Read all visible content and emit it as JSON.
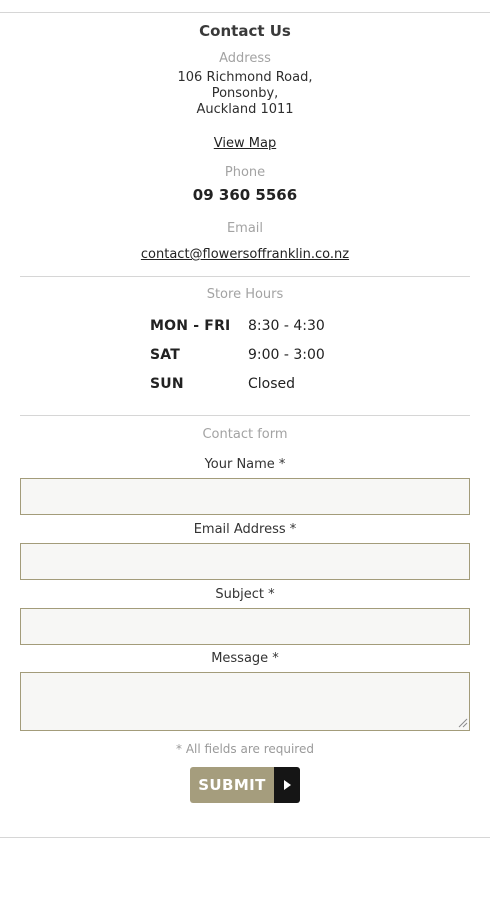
{
  "contact": {
    "title": "Contact Us",
    "address_label": "Address",
    "address_lines": [
      "106 Richmond Road,",
      "Ponsonby,",
      "Auckland 1011"
    ],
    "view_map": "View Map",
    "phone_label": "Phone",
    "phone": "09 360 5566",
    "email_label": "Email",
    "email": "contact@flowersoffranklin.co.nz"
  },
  "hours": {
    "title": "Store Hours",
    "rows": [
      {
        "day": "MON - FRI",
        "time": "8:30 - 4:30"
      },
      {
        "day": "SAT",
        "time": "9:00 - 3:00"
      },
      {
        "day": "SUN",
        "time": "Closed"
      }
    ]
  },
  "form": {
    "title": "Contact form",
    "fields": [
      {
        "label": "Your Name *",
        "value": ""
      },
      {
        "label": "Email Address *",
        "value": ""
      },
      {
        "label": "Subject *",
        "value": ""
      },
      {
        "label": "Message *",
        "value": ""
      }
    ],
    "note": "* All fields are required",
    "submit_label": "SUBMIT"
  },
  "colors": {
    "accent": "#a59d7d",
    "field_border": "#a39c7a",
    "field_bg": "#f7f7f5",
    "arrow_bg": "#151515"
  },
  "icons": {
    "submit_arrow": "play-arrow-icon",
    "textarea_grip": "resize-grip-icon"
  }
}
